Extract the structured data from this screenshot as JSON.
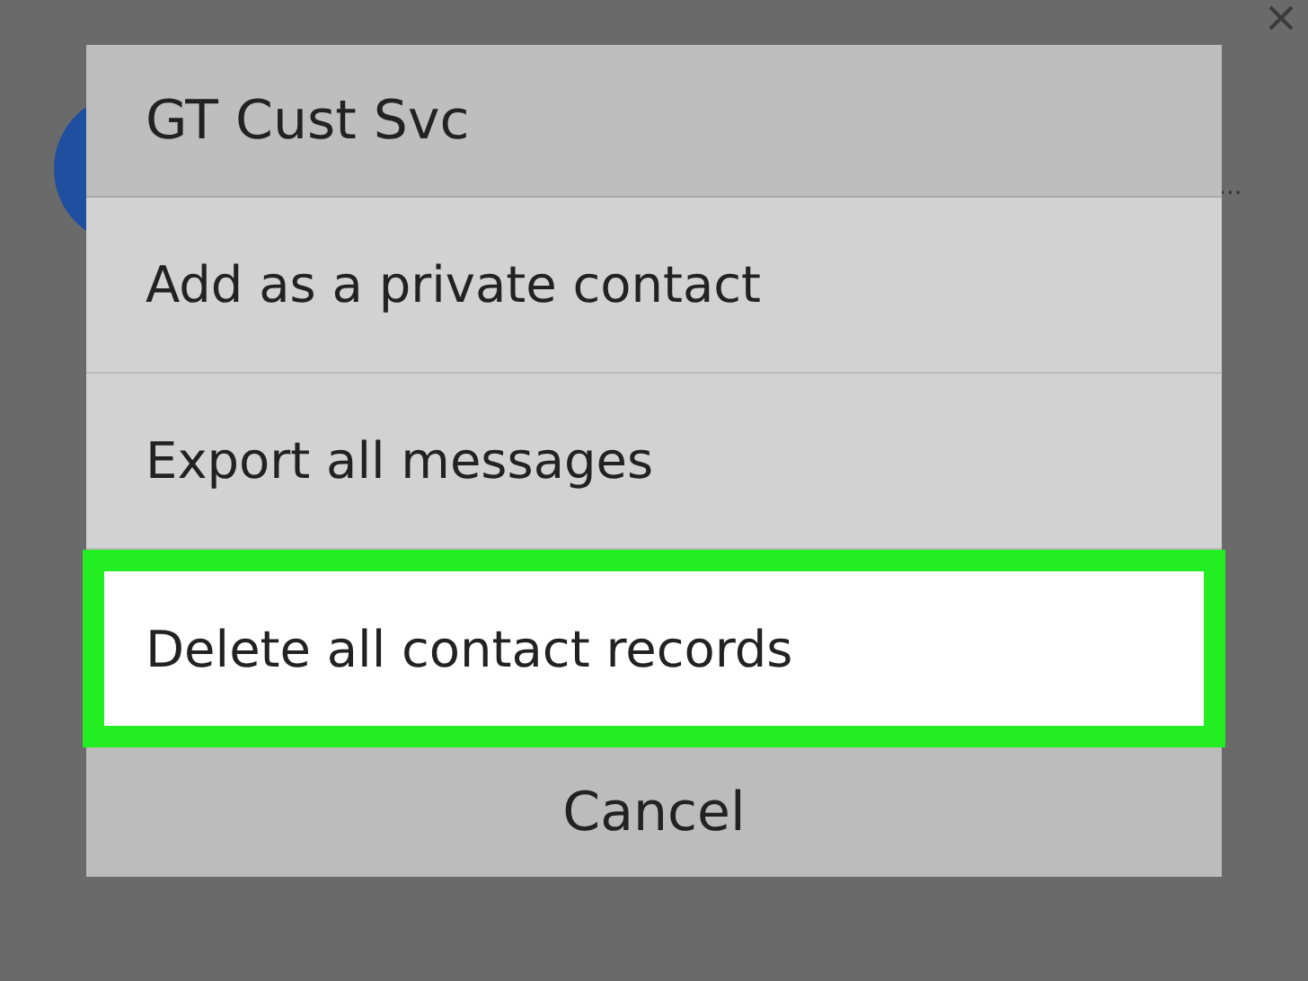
{
  "background": {
    "preview_text": "..."
  },
  "dialog": {
    "title": "GT Cust Svc",
    "items": [
      {
        "label": "Add as a private contact",
        "highlighted": false
      },
      {
        "label": "Export all messages",
        "highlighted": false
      },
      {
        "label": "Delete all contact records",
        "highlighted": true
      }
    ],
    "cancel": "Cancel"
  }
}
